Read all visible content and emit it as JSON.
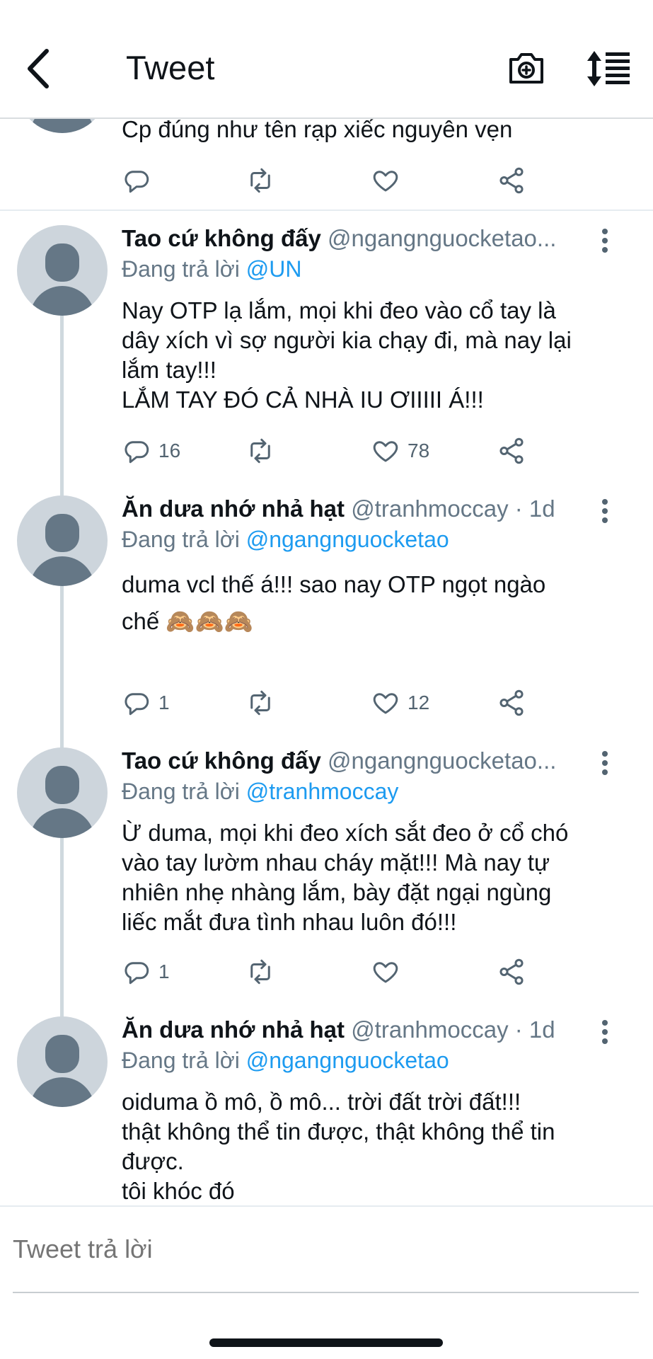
{
  "header": {
    "title": "Tweet",
    "back_icon": "chevron-left-icon",
    "camera_icon": "camera-plus-icon",
    "sort_icon": "sort-list-icon"
  },
  "partial_tweet": {
    "text": "Cp đúng như tên rạp xiếc nguyên vẹn"
  },
  "tweets": [
    {
      "name": "Tao cứ không đấy",
      "handle": "@ngangnguocketao...",
      "reply_prefix": "Đang trả lời",
      "reply_to": "@UN",
      "text": "Nay OTP lạ lắm, mọi khi đeo vào cổ tay là\ndây xích vì sợ người kia chạy đi, mà nay lại\nlắm tay!!!\nLẮM TAY ĐÓ CẢ NHÀ IU ƠIIIII Á!!!",
      "reply_count": "16",
      "like_count": "78"
    },
    {
      "name": "Ăn dưa nhớ nhả hạt",
      "handle": "@tranhmoccay · 1d",
      "reply_prefix": "Đang trả lời",
      "reply_to": "@ngangnguocketao",
      "text": "duma vcl thế á!!! sao nay OTP ngọt ngào\nchế 🙈🙈🙈",
      "reply_count": "1",
      "like_count": "12"
    },
    {
      "name": "Tao cứ không đấy",
      "handle": "@ngangnguocketao...",
      "reply_prefix": "Đang trả lời",
      "reply_to": "@tranhmoccay",
      "text": "Ừ duma, mọi khi đeo xích sắt đeo ở cổ chó\nvào tay lườm nhau cháy mặt!!! Mà nay tự\nnhiên nhẹ nhàng lắm, bày đặt ngại ngùng\nliếc mắt đưa tình nhau luôn đó!!!",
      "reply_count": "1",
      "like_count": ""
    },
    {
      "name": "Ăn dưa nhớ nhả hạt",
      "handle": "@tranhmoccay · 1d",
      "reply_prefix": "Đang trả lời",
      "reply_to": "@ngangnguocketao",
      "text": "oiduma ồ mô, ồ mô... trời đất trời đất!!!\nthật không thể tin được, thật không thể tin\nđược.\ntôi khóc đó",
      "reply_count": "",
      "like_count": ""
    }
  ],
  "composer": {
    "placeholder": "Tweet trả lời"
  },
  "colors": {
    "accent": "#1d9bf0",
    "muted": "#657786",
    "avatar_bg": "#cdd5dc"
  }
}
